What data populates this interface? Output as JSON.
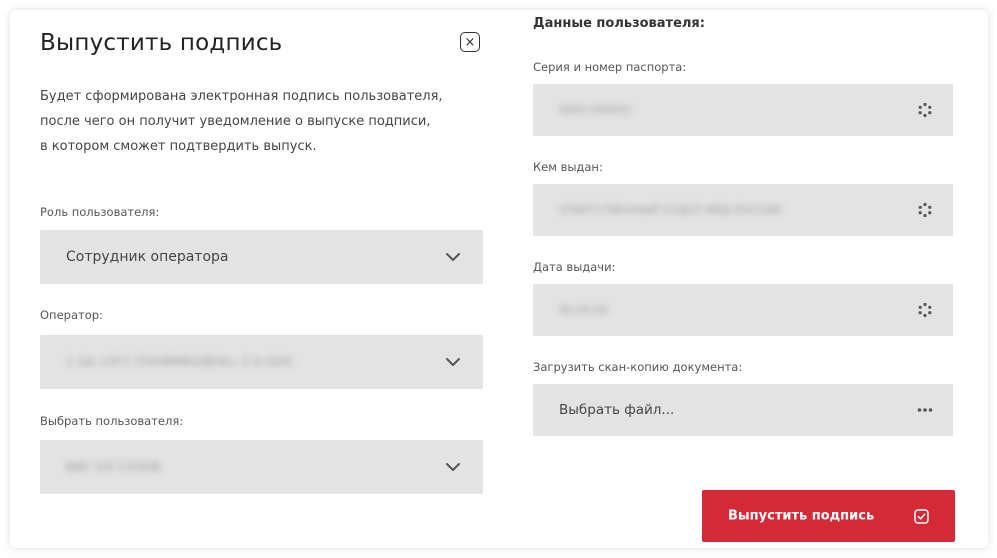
{
  "dialog": {
    "title": "Выпустить подпись",
    "description_lines": [
      "Будет сформирована электронная подпись пользователя,",
      "после чего он получит уведомление о выпуске подписи,",
      "в котором сможет подтвердить выпуск."
    ]
  },
  "left": {
    "role": {
      "label": "Роль пользователя:",
      "value": "Сотрудник оператора"
    },
    "operator": {
      "label": "Оператор:",
      "value": "1 ОА «ПГС-ТОНЯРИКОВОК» 2-4 ООО"
    },
    "user": {
      "label": "Выбрать пользователя:",
      "value": "ВИС ОЛ СЛЗОВ"
    }
  },
  "right": {
    "section_title": "Данные пользователя:",
    "passport": {
      "label": "Серия и номер паспорта:",
      "value": "0000 000001"
    },
    "issued_by": {
      "label": "Кем выдан:",
      "value": "ОТВЕТСТВЕННЫЙ ОТДЕЛ МВД РОССИИ"
    },
    "issue_date": {
      "label": "Дата выдачи:",
      "value": "00.00.00"
    },
    "upload": {
      "label": "Загрузить скан-копию документа:",
      "value": "Выбрать файл..."
    }
  },
  "submit_label": "Выпустить подпись",
  "colors": {
    "primary": "#d42a36",
    "field_bg": "#e3e3e3"
  }
}
